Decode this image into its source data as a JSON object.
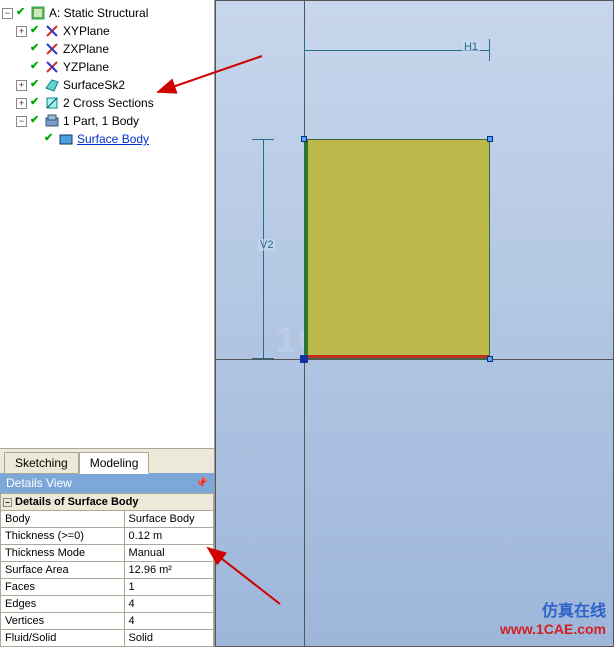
{
  "tree": {
    "root": "A: Static Structural",
    "n1": "XYPlane",
    "n2": "ZXPlane",
    "n3": "YZPlane",
    "n4": "SurfaceSk2",
    "n5": "2 Cross Sections",
    "n6": "1 Part, 1 Body",
    "n7": "Surface Body"
  },
  "tabs": {
    "sketching": "Sketching",
    "modeling": "Modeling"
  },
  "details": {
    "panel_title": "Details View",
    "header": "Details of Surface Body",
    "rows": {
      "body_k": "Body",
      "body_v": "Surface Body",
      "thick_k": "Thickness (>=0)",
      "thick_v": "0.12 m",
      "mode_k": "Thickness Mode",
      "mode_v": "Manual",
      "area_k": "Surface Area",
      "area_v": "12.96 m²",
      "faces_k": "Faces",
      "faces_v": "1",
      "edges_k": "Edges",
      "edges_v": "4",
      "verts_k": "Vertices",
      "verts_v": "4",
      "fs_k": "Fluid/Solid",
      "fs_v": "Solid"
    }
  },
  "viewport": {
    "dim_h": "H1",
    "dim_v": "V2"
  },
  "branding": {
    "cn": "仿真在线",
    "url": "www.1CAE.com"
  }
}
